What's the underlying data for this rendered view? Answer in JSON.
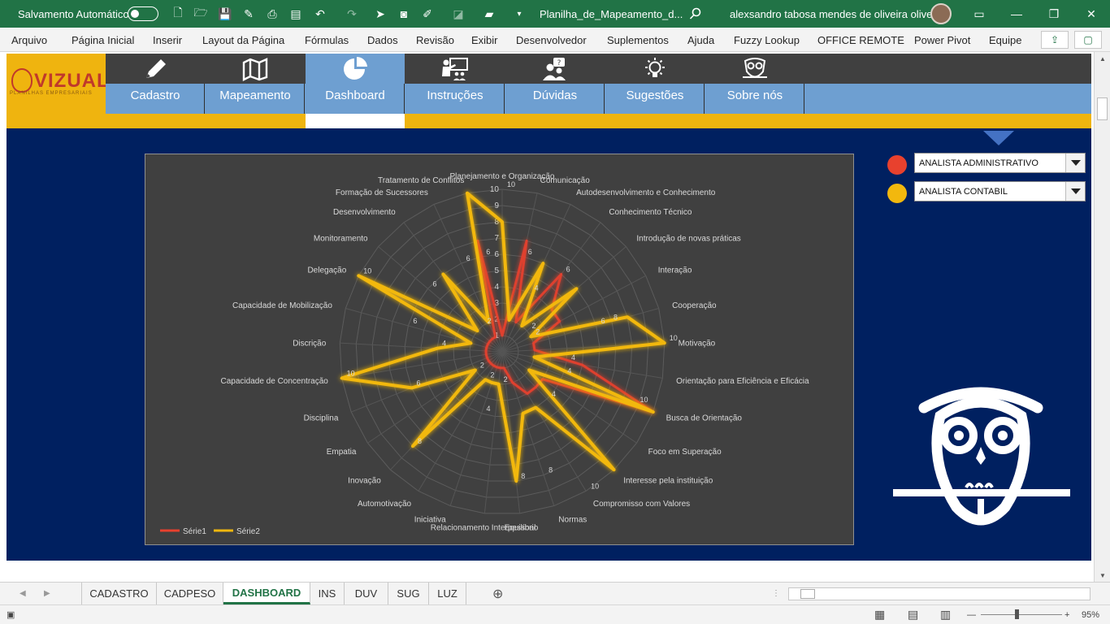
{
  "titlebar": {
    "autosave_label": "Salvamento Automático",
    "filename": "Planilha_de_Mapeamento_d...",
    "user": "alexsandro tabosa mendes de oliveira oliveira"
  },
  "menu": [
    "Arquivo",
    "Página Inicial",
    "Inserir",
    "Layout da Página",
    "Fórmulas",
    "Dados",
    "Revisão",
    "Exibir",
    "Desenvolvedor",
    "Suplementos",
    "Ajuda",
    "Fuzzy Lookup",
    "OFFICE REMOTE",
    "Power Pivot",
    "Equipe"
  ],
  "logo": {
    "brand": "VIZUAL",
    "tagline": "PLANILHAS EMPRESARIAIS"
  },
  "nav": {
    "tabs": [
      {
        "label": "Cadastro",
        "icon": "pencil-icon"
      },
      {
        "label": "Mapeamento",
        "icon": "map-icon"
      },
      {
        "label": "Dashboard",
        "icon": "pie-chart-icon"
      },
      {
        "label": "Instruções",
        "icon": "teacher-icon"
      },
      {
        "label": "Dúvidas",
        "icon": "question-person-icon"
      },
      {
        "label": "Sugestões",
        "icon": "lightbulb-icon"
      },
      {
        "label": "Sobre nós",
        "icon": "owl-icon"
      }
    ],
    "active": "Dashboard"
  },
  "selectors": [
    {
      "value": "ANALISTA ADMINISTRATIVO",
      "color": "#e8412e"
    },
    {
      "value": "ANALISTA CONTABIL",
      "color": "#f2b80e"
    }
  ],
  "chart_data": {
    "type": "radar",
    "rmax": 10,
    "categories": [
      "Planejamento e Organização",
      "Comunicação",
      "Autodesenvolvimento e Conhecimento",
      "Conhecimento Técnico",
      "Introdução de novas práticas",
      "Interação",
      "Cooperação",
      "Motivação",
      "Orientação para Eficiência e Eficácia",
      "Busca de Orientação",
      "Foco em Superação",
      "Interesse pela instituição",
      "Compromisso com Valores",
      "Normas",
      "Equilíbrio",
      "Relacionamento Interpessoal",
      "Iniciativa",
      "Automotivação",
      "Inovação",
      "Empatia",
      "Disciplina",
      "Capacidade de Concentração",
      "Discrição",
      "Capacidade de Mobilização",
      "Delegação",
      "Monitoramento",
      "Desenvolvimento",
      "Formação de Sucessores",
      "Tratamento de Conflitos"
    ],
    "series": [
      {
        "name": "Série1",
        "color": "#e8412e",
        "values": [
          1,
          7,
          2,
          6,
          4,
          4,
          2,
          2,
          5,
          10,
          3,
          3,
          3,
          2,
          1,
          1,
          1,
          1,
          1,
          1,
          1,
          1,
          1,
          1,
          1,
          1,
          1,
          1,
          7
        ]
      },
      {
        "name": "Série2",
        "color": "#f2b80e",
        "values": [
          8,
          2,
          6,
          2,
          6,
          2,
          8,
          10,
          2,
          10,
          2,
          10,
          4,
          4,
          8,
          2,
          2,
          2,
          8,
          2,
          6,
          10,
          4,
          2,
          10,
          2,
          6,
          2,
          10
        ]
      }
    ],
    "data_labels": [
      {
        "cat": "Planejamento e Organização",
        "text": "10"
      },
      {
        "cat": "Comunicação",
        "text": "6"
      },
      {
        "cat": "Autodesenvolvimento e Conhecimento",
        "text": "4"
      },
      {
        "cat": "Conhecimento Técnico",
        "text": "6"
      },
      {
        "cat": "Introdução de novas práticas",
        "text": "2"
      },
      {
        "cat": "Interação",
        "text": "2"
      },
      {
        "cat": "Cooperação",
        "text": "6"
      },
      {
        "cat": "Cooperação",
        "text": "8"
      },
      {
        "cat": "Motivação",
        "text": "10"
      },
      {
        "cat": "Orientação para Eficiência e Eficácia",
        "text": "4"
      },
      {
        "cat": "Busca de Orientação",
        "text": "4"
      },
      {
        "cat": "Busca de Orientação",
        "text": "10"
      },
      {
        "cat": "Interesse pela instituição",
        "text": "4"
      },
      {
        "cat": "Compromisso com Valores",
        "text": "10"
      },
      {
        "cat": "Normas",
        "text": "8"
      },
      {
        "cat": "Equilíbrio",
        "text": "8"
      },
      {
        "cat": "Relacionamento Interpessoal",
        "text": "2"
      },
      {
        "cat": "Iniciativa",
        "text": "4"
      },
      {
        "cat": "Automotivação",
        "text": "2"
      },
      {
        "cat": "Inovação",
        "text": "8"
      },
      {
        "cat": "Empatia",
        "text": "2"
      },
      {
        "cat": "Disciplina",
        "text": "6"
      },
      {
        "cat": "Capacidade de Concentração",
        "text": "10"
      },
      {
        "cat": "Discrição",
        "text": "4"
      },
      {
        "cat": "Capacidade de Mobilização",
        "text": "6"
      },
      {
        "cat": "Delegação",
        "text": "10"
      },
      {
        "cat": "Monitoramento",
        "text": "6"
      },
      {
        "cat": "Desenvolvimento",
        "text": "2"
      },
      {
        "cat": "Formação de Sucessores",
        "text": "6"
      },
      {
        "cat": "Tratamento de Conflitos",
        "text": "6"
      }
    ],
    "grid": true,
    "ticks": [
      1,
      2,
      3,
      4,
      5,
      6,
      7,
      8,
      9,
      10
    ],
    "legend_position": "bottom-left"
  },
  "sheet_tabs": [
    "CADASTRO",
    "CADPESO",
    "DASHBOARD",
    "INS",
    "DUV",
    "SUG",
    "LUZ"
  ],
  "active_sheet": "DASHBOARD",
  "status": {
    "zoom": "95%"
  }
}
